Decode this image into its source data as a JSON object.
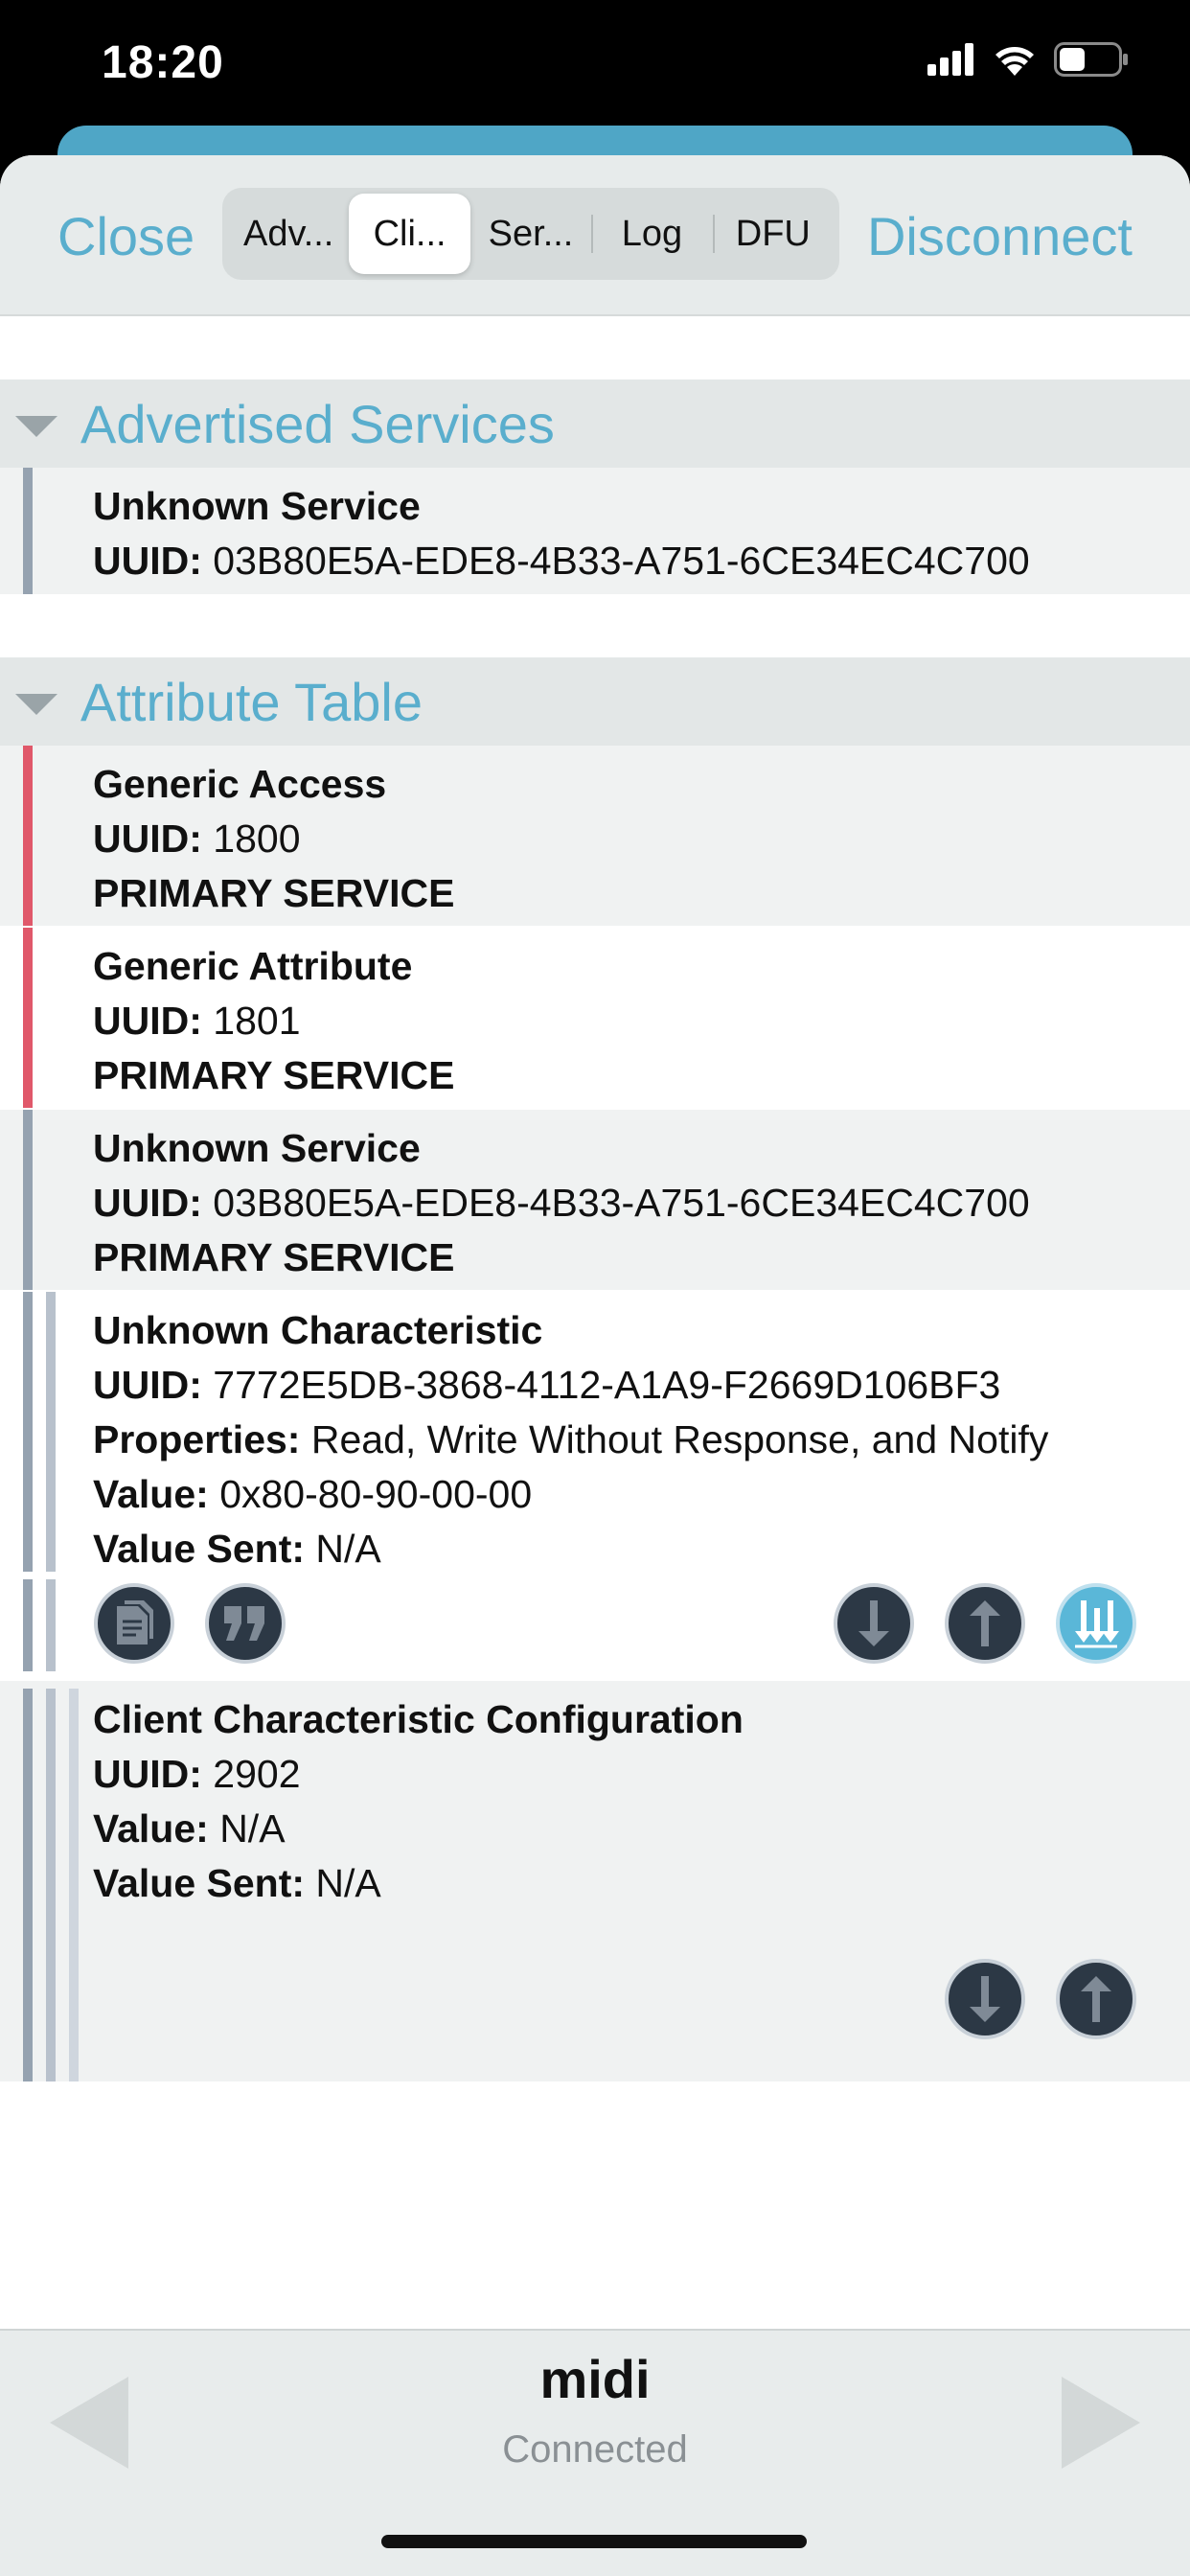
{
  "status_bar": {
    "time": "18:20"
  },
  "toolbar": {
    "close_label": "Close",
    "disconnect_label": "Disconnect",
    "tabs": [
      "Adv...",
      "Cli...",
      "Ser...",
      "Log",
      "DFU"
    ],
    "active_tab": "Cli..."
  },
  "advertised": {
    "title": "Advertised Services",
    "items": [
      {
        "name": "Unknown Service",
        "uuid_label": "UUID:",
        "uuid": "03B80E5A-EDE8-4B33-A751-6CE34EC4C700"
      }
    ]
  },
  "attribute_table": {
    "title": "Attribute Table",
    "services": [
      {
        "name": "Generic Access",
        "uuid_label": "UUID:",
        "uuid": "1800",
        "type": "PRIMARY SERVICE",
        "color": "#e0586a"
      },
      {
        "name": "Generic Attribute",
        "uuid_label": "UUID:",
        "uuid": "1801",
        "type": "PRIMARY SERVICE",
        "color": "#e0586a"
      },
      {
        "name": "Unknown Service",
        "uuid_label": "UUID:",
        "uuid": "03B80E5A-EDE8-4B33-A751-6CE34EC4C700",
        "type": "PRIMARY SERVICE",
        "color": "#95a2b0"
      }
    ],
    "characteristic": {
      "name": "Unknown Characteristic",
      "uuid_label": "UUID:",
      "uuid": "7772E5DB-3868-4112-A1A9-F2669D106BF3",
      "properties_label": "Properties:",
      "properties": "Read, Write Without Response, and Notify",
      "value_label": "Value:",
      "value": "0x80-80-90-00-00",
      "value_sent_label": "Value Sent:",
      "value_sent": "N/A",
      "buttons": [
        "copy-icon",
        "quote-icon",
        "read-down-arrow-icon",
        "write-up-arrow-icon",
        "notify-icon"
      ]
    },
    "descriptor": {
      "name": "Client Characteristic Configuration",
      "uuid_label": "UUID:",
      "uuid": "2902",
      "value_label": "Value:",
      "value": "N/A",
      "value_sent_label": "Value Sent:",
      "value_sent": "N/A",
      "buttons": [
        "read-down-arrow-icon",
        "write-up-arrow-icon"
      ]
    }
  },
  "footer": {
    "device_name": "midi",
    "status": "Connected"
  },
  "colors": {
    "accent": "#5aaecd",
    "service_red": "#e0586a",
    "service_grey": "#95a2b0",
    "notify_active": "#5ab7d8"
  }
}
